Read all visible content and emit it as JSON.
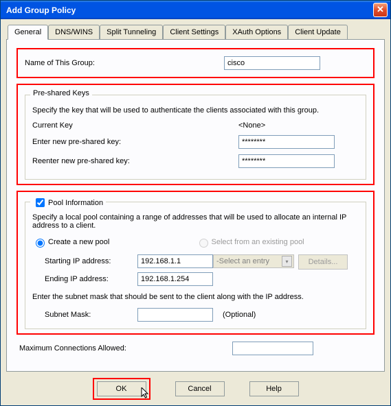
{
  "title": "Add Group Policy",
  "tabs": [
    {
      "label": "General"
    },
    {
      "label": "DNS/WINS"
    },
    {
      "label": "Split Tunneling"
    },
    {
      "label": "Client Settings"
    },
    {
      "label": "XAuth Options"
    },
    {
      "label": "Client Update"
    }
  ],
  "group": {
    "label": "Name of This Group:",
    "value": "cisco"
  },
  "psk": {
    "legend": "Pre-shared Keys",
    "desc": "Specify the key that will be used to authenticate the clients associated with this group.",
    "current_key_label": "Current Key",
    "current_key_value": "<None>",
    "enter_label": "Enter new pre-shared key:",
    "enter_value": "********",
    "reenter_label": "Reenter new pre-shared key:",
    "reenter_value": "********"
  },
  "pool": {
    "legend": "Pool Information",
    "desc": "Specify a local pool containing a range of addresses that will be used to allocate an internal IP address to a client.",
    "radio_new": "Create a new pool",
    "radio_existing": "Select from an existing pool",
    "start_label": "Starting IP address:",
    "start_value": "192.168.1.1",
    "end_label": "Ending IP address:",
    "end_value": "192.168.1.254",
    "select_placeholder": "-Select an entry",
    "details_btn": "Details...",
    "subnet_desc": "Enter the subnet mask that should be sent to the client along with the IP address.",
    "subnet_label": "Subnet Mask:",
    "subnet_value": "",
    "subnet_opt": "(Optional)"
  },
  "max_label": "Maximum Connections Allowed:",
  "max_value": "",
  "buttons": {
    "ok": "OK",
    "cancel": "Cancel",
    "help": "Help"
  }
}
